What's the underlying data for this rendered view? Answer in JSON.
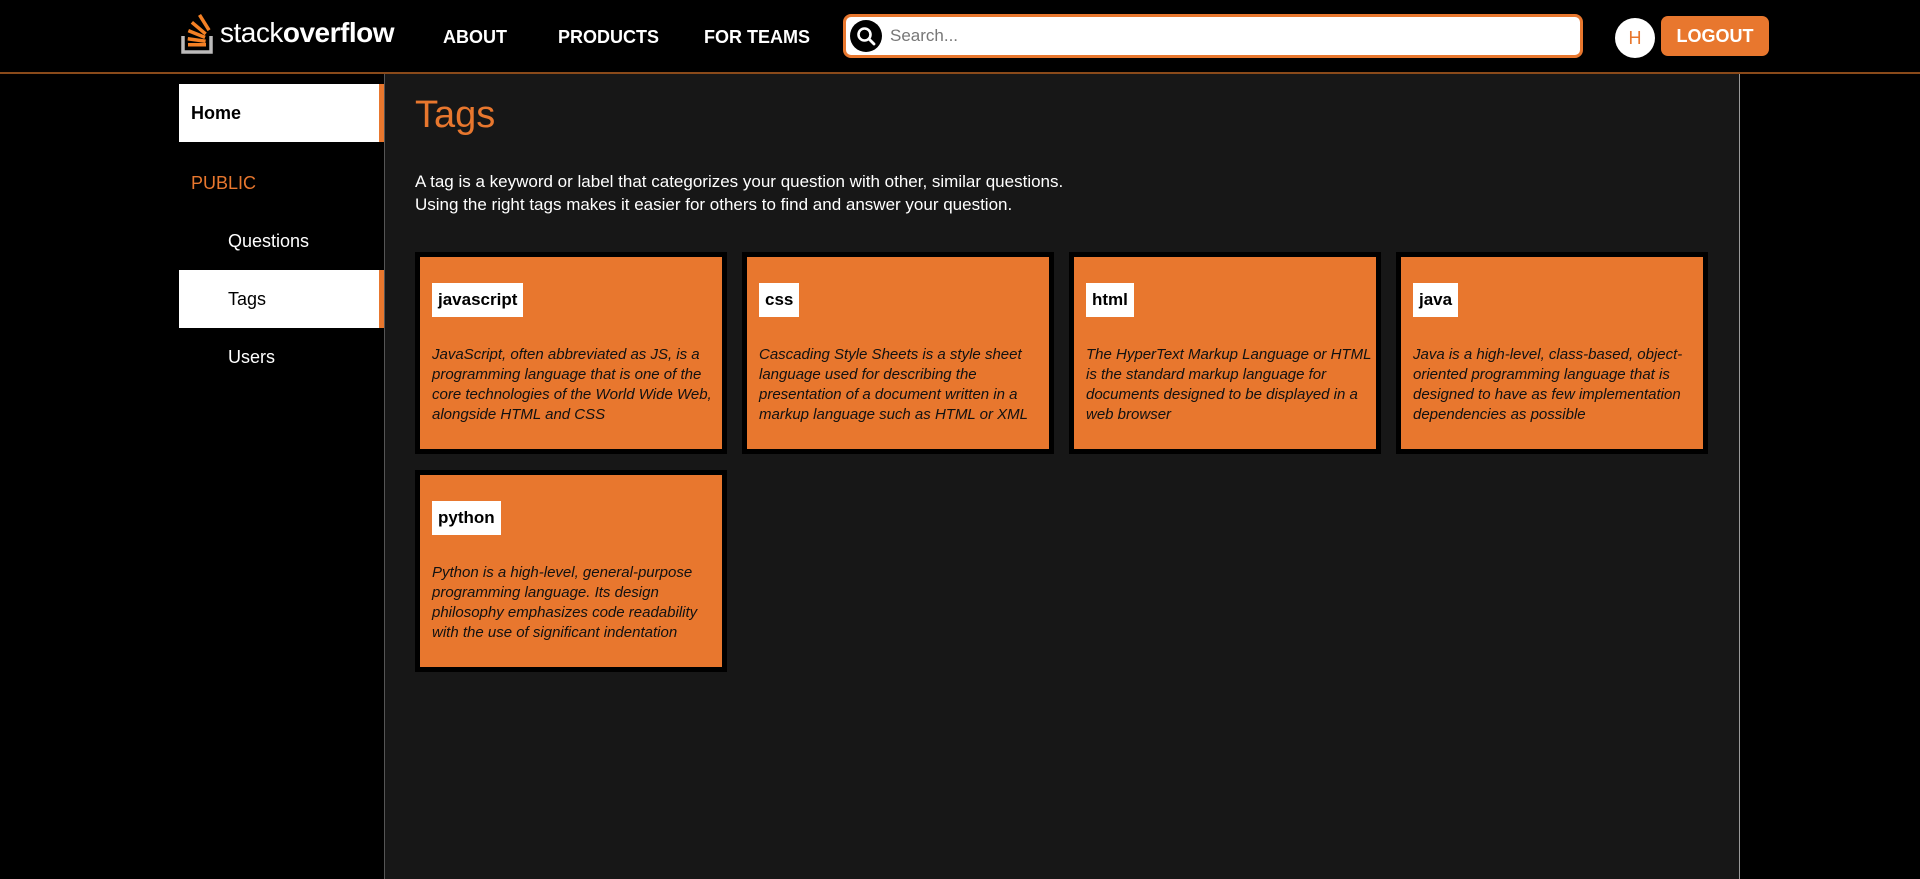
{
  "header": {
    "logo": {
      "text_light": "stack",
      "text_bold": "overflow"
    },
    "nav": {
      "about": "ABOUT",
      "products": "PRODUCTS",
      "teams": "FOR TEAMS"
    },
    "search": {
      "placeholder": "Search...",
      "value": ""
    },
    "avatar_initial": "H",
    "logout_label": "LOGOUT"
  },
  "sidebar": {
    "home": "Home",
    "public": "PUBLIC",
    "questions": "Questions",
    "tags": "Tags",
    "users": "Users"
  },
  "main": {
    "title": "Tags",
    "description_line1": "A tag is a keyword or label that categorizes your question with other, similar questions.",
    "description_line2": "Using the right tags makes it easier for others to find and answer your question.",
    "tags": [
      {
        "name": "javascript",
        "description": "JavaScript, often abbreviated as JS, is a programming language that is one of the core technologies of the World Wide Web, alongside HTML and CSS"
      },
      {
        "name": "css",
        "description": "Cascading Style Sheets is a style sheet language used for describing the presentation of a document written in a markup language such as HTML or XML"
      },
      {
        "name": "html",
        "description": "The HyperText Markup Language or HTML is the standard markup language for documents designed to be displayed in a web browser"
      },
      {
        "name": "java",
        "description": "Java is a high-level, class-based, object-oriented programming language that is designed to have as few implementation dependencies as possible"
      },
      {
        "name": "python",
        "description": "Python is a high-level, general-purpose programming language. Its design philosophy emphasizes code readability with the use of significant indentation"
      }
    ]
  },
  "colors": {
    "accent": "#e8772e",
    "background": "#000000",
    "panel": "#171717"
  },
  "icons": {
    "logo": "stackoverflow-logo-icon",
    "search": "search-icon"
  }
}
